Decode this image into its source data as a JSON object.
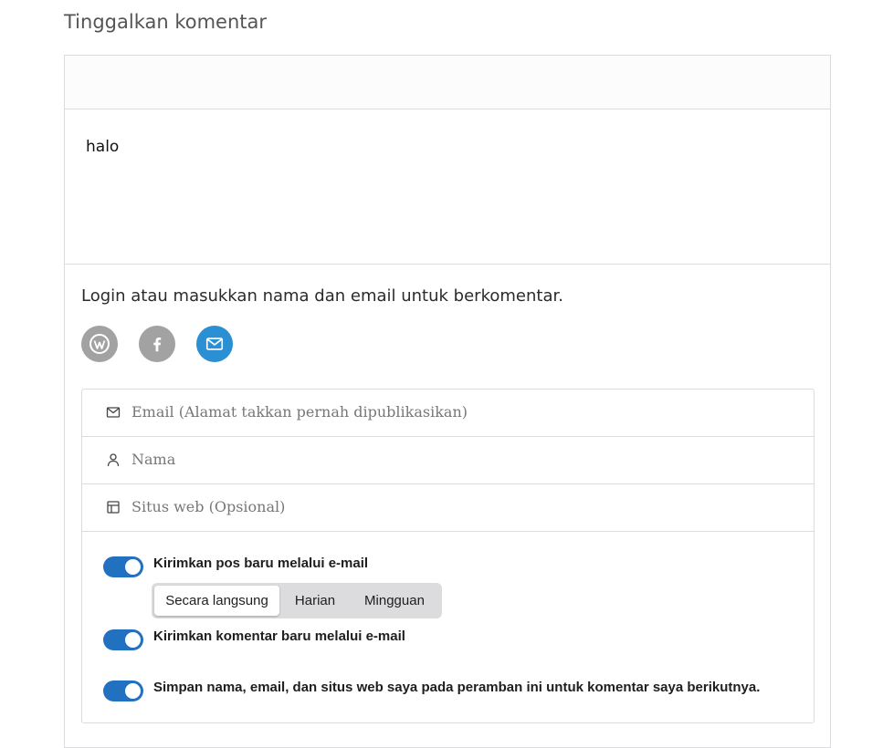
{
  "heading": "Tinggalkan komentar",
  "comment": {
    "text": "halo"
  },
  "login": {
    "prompt": "Login atau masukkan nama dan email untuk berkomentar."
  },
  "social": [
    {
      "icon": "wordpress-icon",
      "color": "#a2a2a2"
    },
    {
      "icon": "facebook-icon",
      "color": "#a2a2a2"
    },
    {
      "icon": "mail-icon",
      "color": "#2b8fd4"
    }
  ],
  "fields": {
    "email_placeholder": "Email (Alamat takkan pernah dipublikasikan)",
    "name_placeholder": "Nama",
    "website_placeholder": "Situs web (Opsional)"
  },
  "options": {
    "subscribe_posts_label": "Kirimkan pos baru melalui e-mail",
    "frequency": [
      "Secara langsung",
      "Harian",
      "Mingguan"
    ],
    "frequency_selected": "Secara langsung",
    "subscribe_comments_label": "Kirimkan komentar baru melalui e-mail",
    "save_info_label": "Simpan nama, email, dan situs web saya pada peramban ini untuk komentar saya berikutnya."
  },
  "colors": {
    "accent": "#2271c1",
    "mail_button": "#2b8fd4",
    "social_gray": "#a2a2a2"
  }
}
